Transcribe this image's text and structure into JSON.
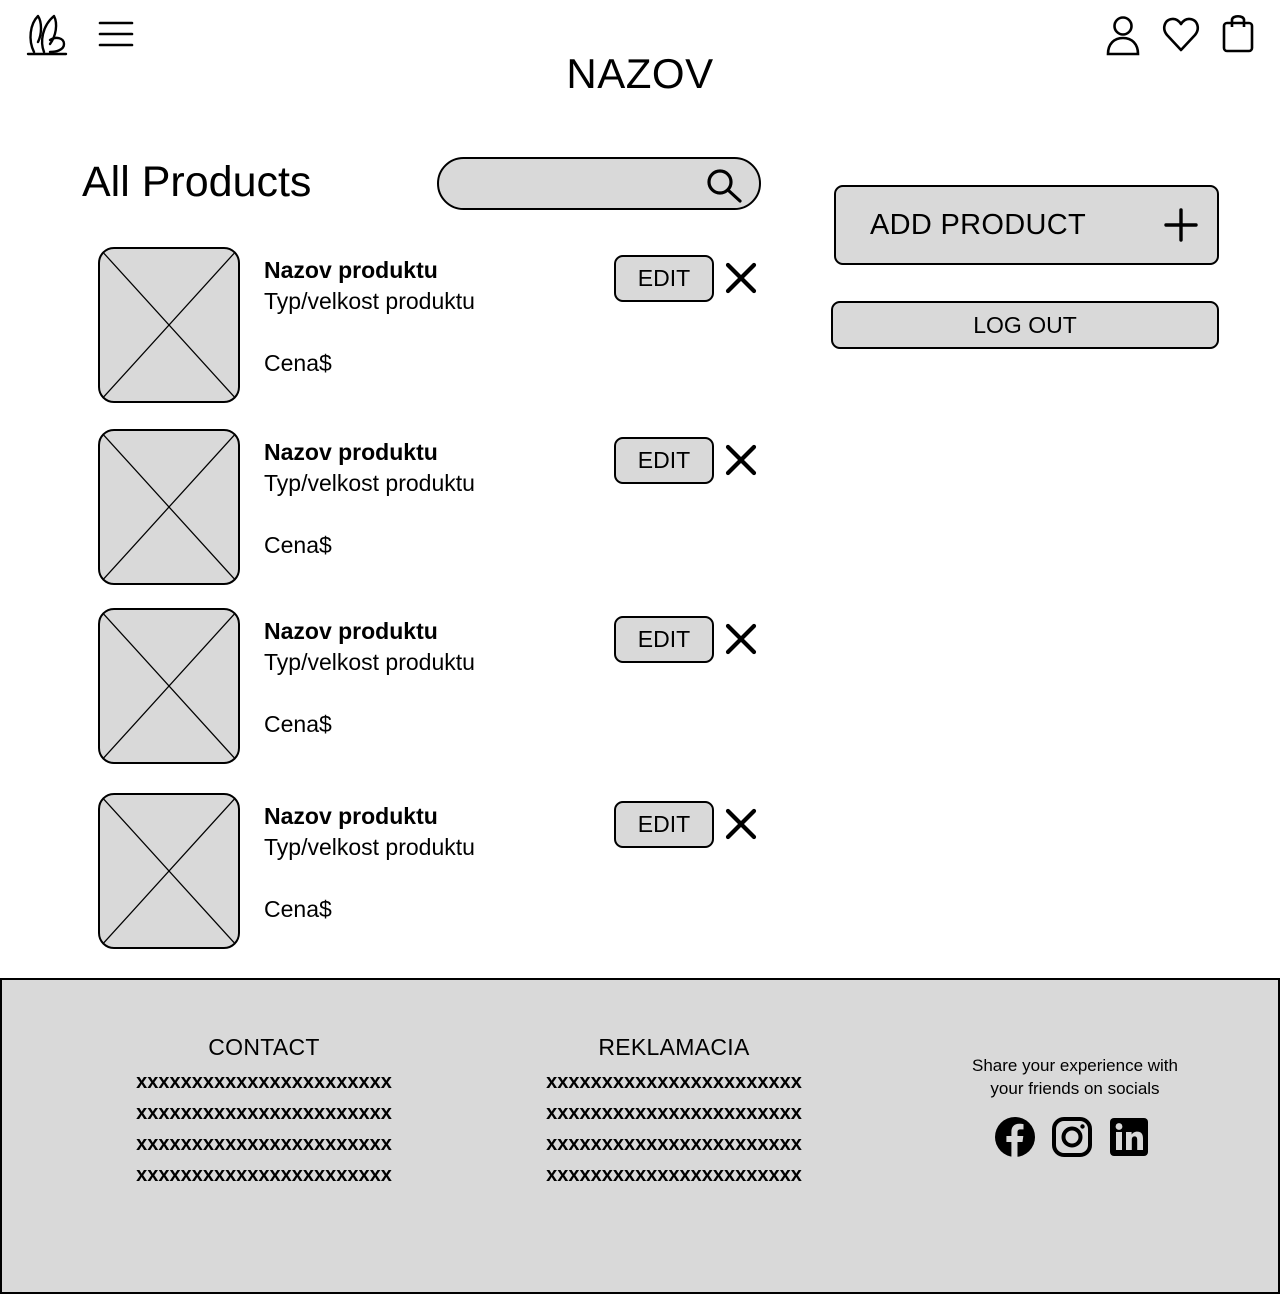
{
  "header": {
    "brand_title": "NAZOV",
    "icons": [
      "logo-icon",
      "menu-icon",
      "user-icon",
      "heart-icon",
      "bag-icon"
    ]
  },
  "products_section": {
    "heading": "All Products",
    "search": {
      "value": "",
      "placeholder": ""
    },
    "items": [
      {
        "name": "Nazov produktu",
        "type": "Typ/velkost produktu",
        "price": "Cena$",
        "edit_label": "EDIT"
      },
      {
        "name": "Nazov produktu",
        "type": "Typ/velkost produktu",
        "price": "Cena$",
        "edit_label": "EDIT"
      },
      {
        "name": "Nazov produktu",
        "type": "Typ/velkost produktu",
        "price": "Cena$",
        "edit_label": "EDIT"
      },
      {
        "name": "Nazov produktu",
        "type": "Typ/velkost produktu",
        "price": "Cena$",
        "edit_label": "EDIT"
      }
    ]
  },
  "actions": {
    "add_product_label": "ADD PRODUCT",
    "logout_label": "LOG OUT"
  },
  "footer": {
    "contact": {
      "title": "CONTACT",
      "lines": [
        "xxxxxxxxxxxxxxxxxxxxxxx",
        "xxxxxxxxxxxxxxxxxxxxxxx",
        "xxxxxxxxxxxxxxxxxxxxxxx",
        "xxxxxxxxxxxxxxxxxxxxxxx"
      ]
    },
    "reklamacia": {
      "title": "REKLAMACIA",
      "lines": [
        "xxxxxxxxxxxxxxxxxxxxxxx",
        "xxxxxxxxxxxxxxxxxxxxxxx",
        "xxxxxxxxxxxxxxxxxxxxxxx",
        "xxxxxxxxxxxxxxxxxxxxxxx"
      ]
    },
    "social": {
      "line1": "Share your experience with",
      "line2": "your friends on socials",
      "icons": [
        "facebook-icon",
        "instagram-icon",
        "linkedin-icon"
      ]
    }
  },
  "colors": {
    "panel_gray": "#d9d9d9",
    "ink": "#000000",
    "background": "#ffffff"
  }
}
